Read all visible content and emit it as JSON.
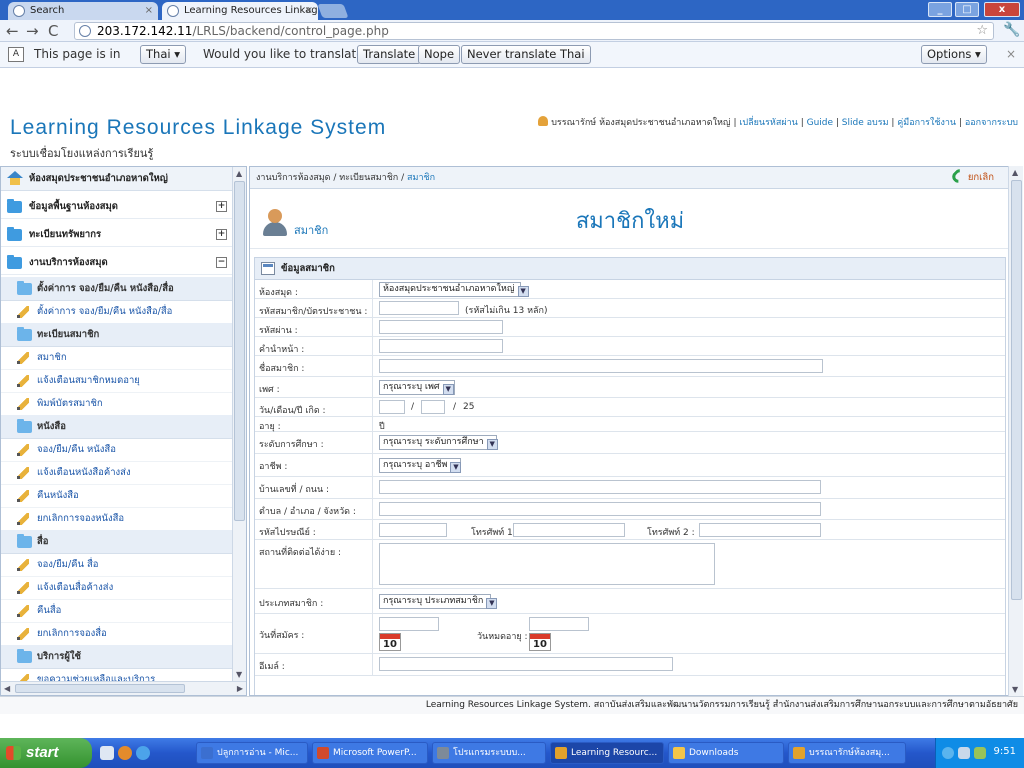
{
  "browser": {
    "tabs": [
      {
        "label": "Search"
      },
      {
        "label": "Learning Resources Linkage Sy"
      }
    ],
    "url_host": "203.172.142.11",
    "url_path": "/LRLS/backend/control_page.php",
    "translate_bar": {
      "text_before": "This page is in",
      "language": "Thai",
      "question": "Would you like to translate it?",
      "translate_label": "Translate",
      "nope_label": "Nope",
      "never_label": "Never translate Thai",
      "options_label": "Options"
    }
  },
  "site": {
    "title": "Learning Resources Linkage System",
    "subtitle": "ระบบเชื่อมโยงแหล่งการเรียนรู้",
    "user": "บรรณารักษ์ ห้องสมุดประชาชนอำเภอหาดใหญ่",
    "links": [
      "เปลี่ยนรหัสผ่าน",
      "Guide",
      "Slide อบรม",
      "คู่มือการใช้งาน",
      "ออกจากระบบ"
    ]
  },
  "sidebar": {
    "library": "ห้องสมุดประชาชนอำเภอหาดใหญ่",
    "groups": [
      {
        "label": "ข้อมูลพื้นฐานห้องสมุด",
        "toggle": "+"
      },
      {
        "label": "ทะเบียนทรัพยากร",
        "toggle": "+"
      },
      {
        "label": "งานบริการห้องสมุด",
        "toggle": "−"
      }
    ],
    "items": [
      {
        "label": "ตั้งค่าการ จอง/ยืม/คืน หนังสือ/สื่อ",
        "kind": "sub"
      },
      {
        "label": "ตั้งค่าการ จอง/ยืม/คืน หนังสือ/สื่อ",
        "kind": "item"
      },
      {
        "label": "ทะเบียนสมาชิก",
        "kind": "sub"
      },
      {
        "label": "สมาชิก",
        "kind": "item"
      },
      {
        "label": "แจ้งเตือนสมาชิกหมดอายุ",
        "kind": "item"
      },
      {
        "label": "พิมพ์บัตรสมาชิก",
        "kind": "item"
      },
      {
        "label": "หนังสือ",
        "kind": "sub"
      },
      {
        "label": "จอง/ยืม/คืน หนังสือ",
        "kind": "item"
      },
      {
        "label": "แจ้งเตือนหนังสือค้างส่ง",
        "kind": "item"
      },
      {
        "label": "คืนหนังสือ",
        "kind": "item"
      },
      {
        "label": "ยกเลิกการจองหนังสือ",
        "kind": "item"
      },
      {
        "label": "สื่อ",
        "kind": "sub"
      },
      {
        "label": "จอง/ยืม/คืน สื่อ",
        "kind": "item"
      },
      {
        "label": "แจ้งเตือนสื่อค้างส่ง",
        "kind": "item"
      },
      {
        "label": "คืนสื่อ",
        "kind": "item"
      },
      {
        "label": "ยกเลิกการจองสื่อ",
        "kind": "item"
      },
      {
        "label": "บริการผู้ใช้",
        "kind": "sub"
      },
      {
        "label": "ขอความช่วยเหลือและบริการ",
        "kind": "item"
      }
    ]
  },
  "main": {
    "breadcrumb_a": "งานบริการห้องสมุด / ทะเบียนสมาชิก / ",
    "breadcrumb_current": "สมาชิก",
    "back_label": "ยกเลิก",
    "page_label": "สมาชิก",
    "page_title": "สมาชิกใหม่",
    "form_title": "ข้อมูลสมาชิก",
    "fields": {
      "library": {
        "label": "ห้องสมุด :",
        "value": "ห้องสมุดประชาชนอำเภอหาดใหญ่"
      },
      "member_id": {
        "label": "รหัสสมาชิก/บัตรประชาชน :",
        "hint": "(รหัสไม่เกิน 13 หลัก)"
      },
      "password": {
        "label": "รหัสผ่าน :"
      },
      "prefix": {
        "label": "คำนำหน้า :"
      },
      "name": {
        "label": "ชื่อสมาชิก :"
      },
      "gender": {
        "label": "เพศ :",
        "value": "กรุณาระบุ เพศ"
      },
      "birthdate": {
        "label": "วัน/เดือน/ปี เกิด :",
        "sep1": "/",
        "sep2": "/",
        "year": "25"
      },
      "age": {
        "label": "อายุ :",
        "unit": "ปี"
      },
      "education": {
        "label": "ระดับการศึกษา :",
        "value": "กรุณาระบุ ระดับการศึกษา"
      },
      "occupation": {
        "label": "อาชีพ :",
        "value": "กรุณาระบุ อาชีพ"
      },
      "address": {
        "label": "บ้านเลขที่ / ถนน :"
      },
      "district": {
        "label": "ตำบล / อำเภอ / จังหวัด :"
      },
      "postcode": {
        "label": "รหัสไปรษณีย์ :",
        "phone1": "โทรศัพท์ 1 :",
        "phone2": "โทรศัพท์ 2 :"
      },
      "contact": {
        "label": "สถานที่ติดต่อได้ง่าย :"
      },
      "member_type": {
        "label": "ประเภทสมาชิก :",
        "value": "กรุณาระบุ ประเภทสมาชิก"
      },
      "apply_date": {
        "label": "วันที่สมัคร :",
        "expire": "วันหมดอายุ :",
        "cal": "10"
      },
      "email": {
        "label": "อีเมล์ :"
      }
    }
  },
  "status": "Learning Resources Linkage System. สถาบันส่งเสริมและพัฒนานวัตกรรมการเรียนรู้ สำนักงานส่งเสริมการศึกษานอกระบบและการศึกษาตามอัธยาศัย",
  "taskbar": {
    "start": "start",
    "tasks": [
      "ปลูกการอ่าน - Mic...",
      "Microsoft PowerP...",
      "โปรแกรมระบบบ...",
      "Learning Resourc...",
      "Downloads",
      "บรรณารักษ์ห้องสมุ..."
    ],
    "clock": "9:51"
  },
  "colors": {
    "accent": "#1a76b9",
    "taskbar": "#2457cb",
    "start": "#34922f"
  }
}
